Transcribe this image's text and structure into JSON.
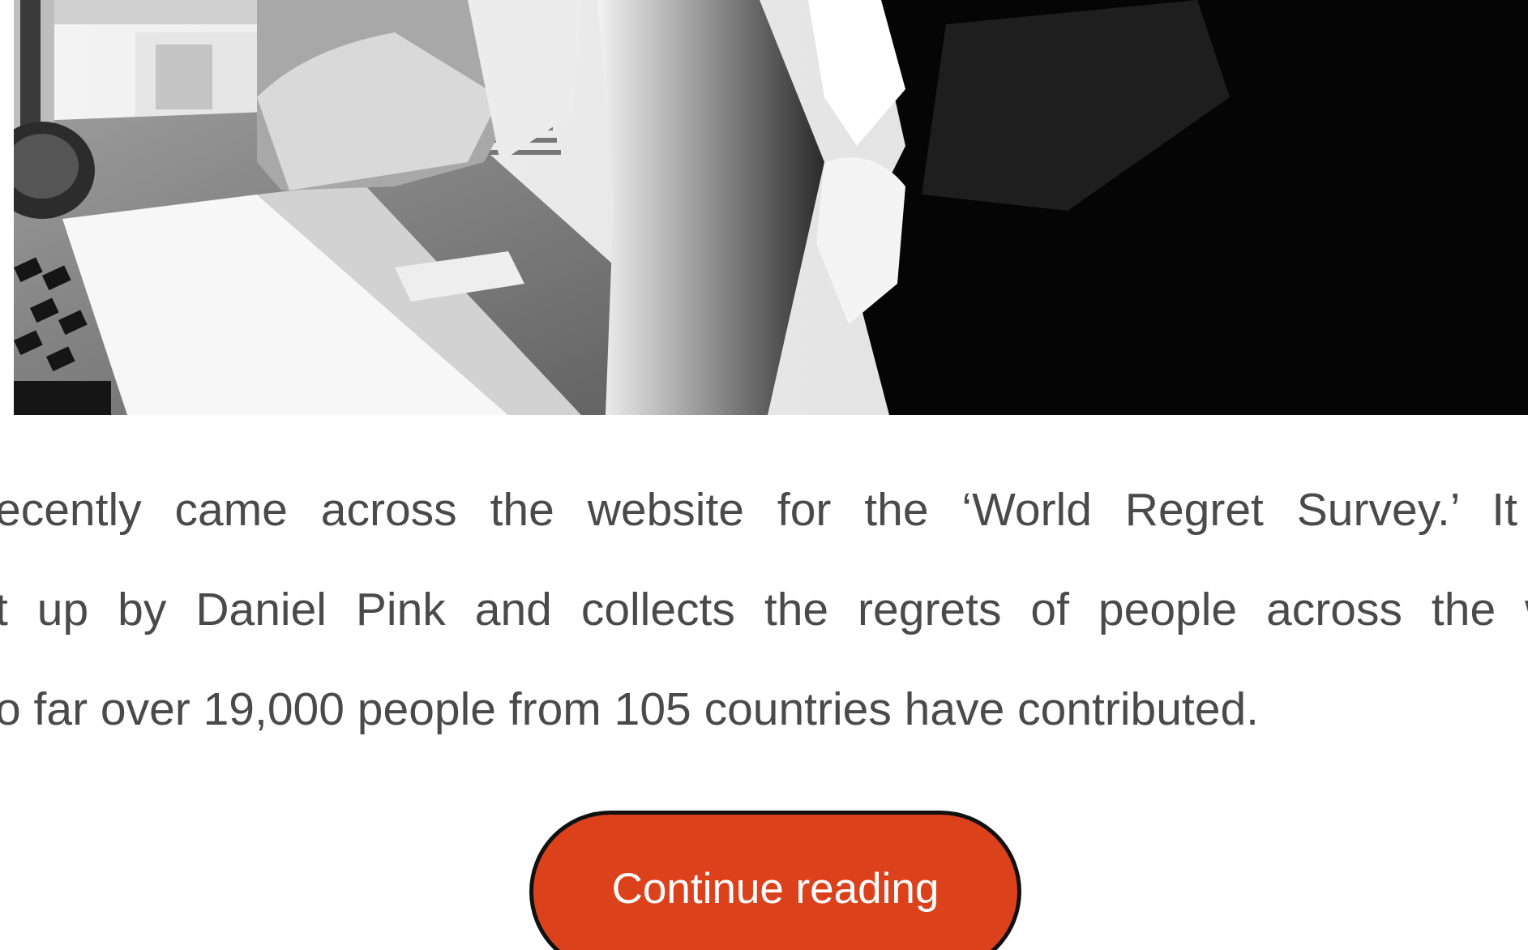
{
  "post": {
    "image_alt": "Black and white photo of a person seated at a desk with a laptop and keyboard",
    "excerpt_lines": [
      "ecently came across the website for the ‘World Regret Survey.’ It w",
      "t up by Daniel Pink and collects the regrets of people across the wo",
      "o far over 19,000 people from 105 countries have contributed."
    ],
    "continue_label": "Continue reading"
  },
  "colors": {
    "text": "#4a4a4a",
    "button_bg": "#db421c",
    "button_border": "#111111",
    "button_text": "#ffffff"
  },
  "icons": {
    "photo": "hero-photo"
  }
}
